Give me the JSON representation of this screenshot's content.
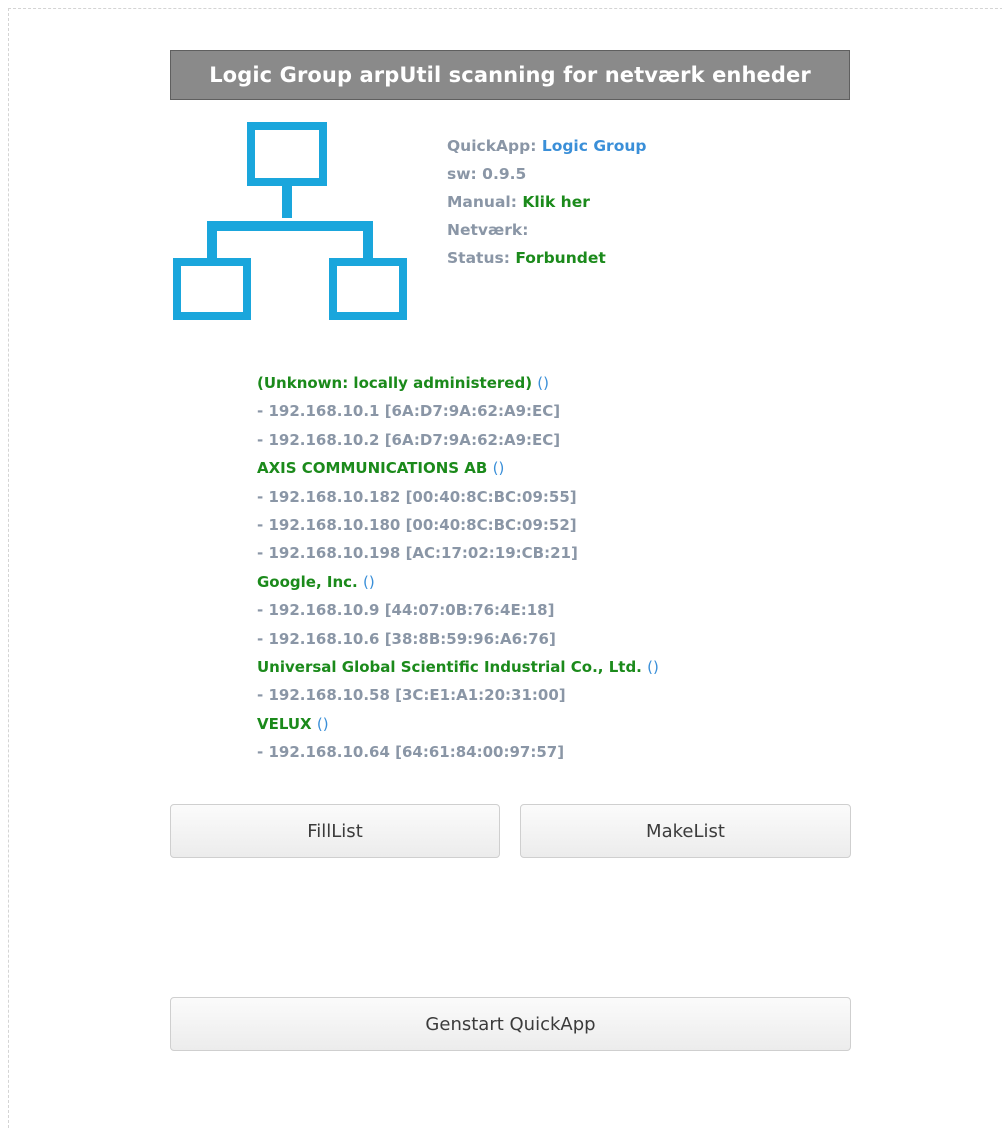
{
  "title": "Logic Group arpUtil scanning for netværk enheder",
  "info": {
    "quickapp_label": "QuickApp:",
    "quickapp_value": "Logic Group",
    "sw_label": "sw:",
    "sw_value": "0.9.5",
    "manual_label": "Manual:",
    "manual_link": "Klik her",
    "network_label": "Netværk:",
    "status_label": "Status:",
    "status_value": "Forbundet"
  },
  "devices": [
    {
      "vendor": "(Unknown: locally administered)",
      "paren": "()",
      "entries": [
        "- 192.168.10.1 [6A:D7:9A:62:A9:EC]",
        "- 192.168.10.2 [6A:D7:9A:62:A9:EC]"
      ]
    },
    {
      "vendor": "AXIS COMMUNICATIONS AB",
      "paren": "()",
      "entries": [
        "- 192.168.10.182 [00:40:8C:BC:09:55]",
        "- 192.168.10.180 [00:40:8C:BC:09:52]",
        "- 192.168.10.198 [AC:17:02:19:CB:21]"
      ]
    },
    {
      "vendor": "Google, Inc.",
      "paren": "()",
      "entries": [
        "- 192.168.10.9 [44:07:0B:76:4E:18]",
        "- 192.168.10.6 [38:8B:59:96:A6:76]"
      ]
    },
    {
      "vendor": "Universal Global Scientific Industrial Co., Ltd.",
      "paren": "()",
      "entries": [
        "- 192.168.10.58 [3C:E1:A1:20:31:00]"
      ]
    },
    {
      "vendor": "VELUX",
      "paren": "()",
      "entries": [
        "- 192.168.10.64 [64:61:84:00:97:57]"
      ]
    }
  ],
  "buttons": {
    "fill": "FillList",
    "make": "MakeList",
    "restart": "Genstart QuickApp"
  },
  "colors": {
    "accent_blue": "#3a8fd8",
    "status_green": "#1b8a1b",
    "icon_cyan": "#1aa6dc",
    "title_bg": "#8a8a8a"
  },
  "icons": {
    "network": "network-topology-icon"
  }
}
